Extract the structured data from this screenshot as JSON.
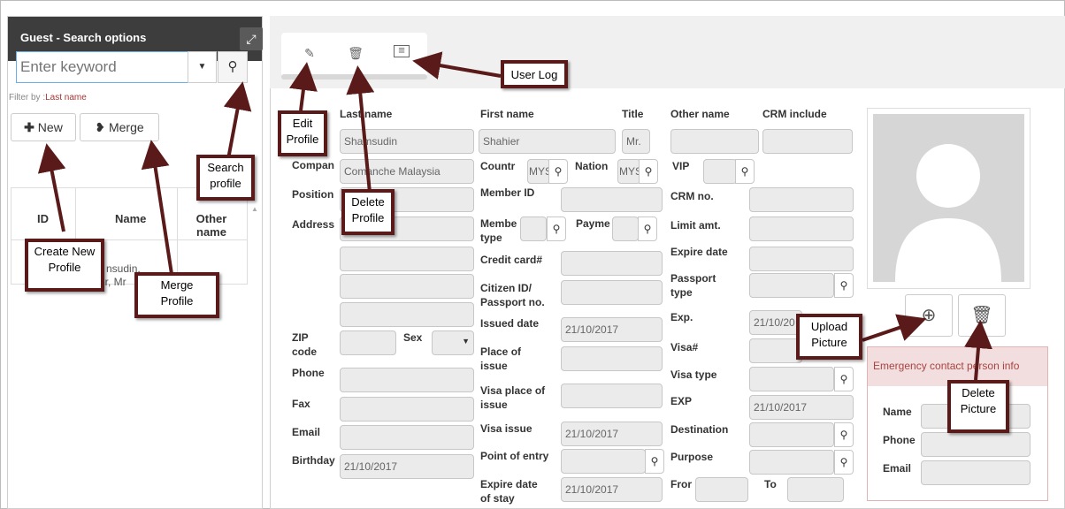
{
  "left_panel": {
    "title": "Guest - Search options",
    "expand_icon": "expand-icon",
    "search_placeholder": "Enter keyword",
    "filter_prefix": "Filter by :",
    "filter_value": "Last name",
    "new_label": "New",
    "merge_label": "Merge",
    "col_id": "ID",
    "col_name": "Name",
    "col_other": "Other name",
    "row_name_line1": "nsudin,",
    "row_name_line2": "er, Mr"
  },
  "toolbar": {
    "edit_icon": "edit-icon",
    "delete_icon": "trash-icon",
    "log_icon": "log-icon"
  },
  "form": {
    "last_name_lbl": "Last name",
    "first_name_lbl": "First name",
    "title_lbl": "Title",
    "other_name_lbl": "Other name",
    "crm_include_lbl": "CRM include",
    "last_name": "Shamsudin",
    "first_name": "Shahier",
    "title": "Mr.",
    "company_lbl": "Compan",
    "company": "Comanche Malaysia",
    "country_lbl": "Countr",
    "country": "MYS",
    "nation_lbl": "Nation",
    "nation": "MYS",
    "vip_lbl": "VIP",
    "position_lbl": "Position",
    "member_id_lbl": "Member ID",
    "crm_no_lbl": "CRM no.",
    "address_lbl": "Address",
    "member_type_lbl1": "Membe",
    "member_type_lbl2": "type",
    "payment_lbl": "Payme",
    "limit_lbl": "Limit amt.",
    "credit_card_lbl": "Credit card#",
    "expire_date_lbl": "Expire date",
    "citizen_lbl1": "Citizen ID/",
    "citizen_lbl2": "Passport no.",
    "passport_type_lbl1": "Passport",
    "passport_type_lbl2": "type",
    "issued_lbl": "Issued date",
    "issued": "21/10/2017",
    "exp_lbl": "Exp.",
    "exp": "21/10/20",
    "zip_lbl1": "ZIP",
    "zip_lbl2": "code",
    "sex_lbl": "Sex",
    "place_issue_lbl1": "Place of",
    "place_issue_lbl2": "issue",
    "visa_no_lbl": "Visa#",
    "phone_lbl": "Phone",
    "visa_type_lbl": "Visa type",
    "fax_lbl": "Fax",
    "visa_place_lbl1": "Visa place of",
    "visa_place_lbl2": "issue",
    "exp2_lbl": "EXP",
    "exp2": "21/10/2017",
    "email_lbl": "Email",
    "visa_issue_lbl": "Visa issue",
    "visa_issue": "21/10/2017",
    "destination_lbl": "Destination",
    "birthday_lbl": "Birthday",
    "birthday": "21/10/2017",
    "point_entry_lbl": "Point of entry",
    "purpose_lbl": "Purpose",
    "expire_stay_lbl1": "Expire date",
    "expire_stay_lbl2": "of stay",
    "expire_stay": "21/10/2017",
    "from_lbl": "Fror",
    "to_lbl": "To"
  },
  "emergency": {
    "header": "Emergency contact person info",
    "name_lbl": "Name",
    "phone_lbl": "Phone",
    "email_lbl": "Email"
  },
  "callouts": {
    "user_log": "User Log",
    "edit1": "Edit",
    "edit2": "Profile",
    "delete1": "Delete",
    "delete2": "Profile",
    "search1": "Search",
    "search2": "profile",
    "create1": "Create New",
    "create2": "Profile",
    "merge1": "Merge",
    "merge2": "Profile",
    "upload1": "Upload",
    "upload2": "Picture",
    "delpic1": "Delete",
    "delpic2": "Picture"
  },
  "colors": {
    "callout_border": "#5a1a1a",
    "header_bg": "#3d3d3d",
    "emergency_bg": "#f2dede"
  }
}
